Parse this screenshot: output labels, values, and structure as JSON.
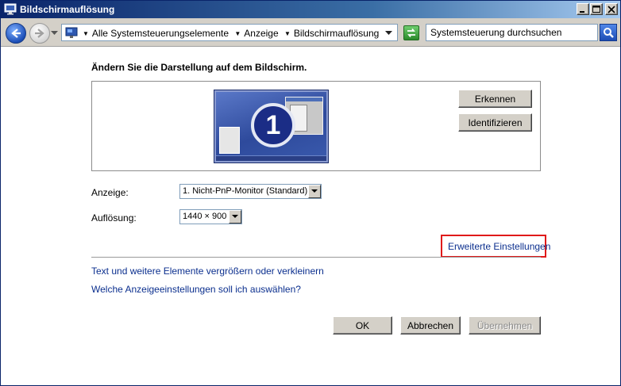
{
  "window": {
    "title": "Bildschirmauflösung"
  },
  "address": {
    "breadcrumbs": [
      "Alle Systemsteuerungselemente",
      "Anzeige",
      "Bildschirmauflösung"
    ],
    "search_placeholder": "Systemsteuerung durchsuchen"
  },
  "main": {
    "heading": "Ändern Sie die Darstellung auf dem Bildschirm.",
    "monitor_number": "1",
    "detect_label": "Erkennen",
    "identify_label": "Identifizieren",
    "display_label": "Anzeige:",
    "display_value": "1. Nicht-PnP-Monitor (Standard)",
    "resolution_label": "Auflösung:",
    "resolution_value": "1440 × 900",
    "advanced_link": "Erweiterte Einstellungen",
    "text_size_link": "Text und weitere Elemente vergrößern oder verkleinern",
    "which_settings_link": "Welche Anzeigeeinstellungen soll ich auswählen?"
  },
  "footer": {
    "ok_label": "OK",
    "cancel_label": "Abbrechen",
    "apply_label": "Übernehmen"
  },
  "colors": {
    "highlight": "#e01a1a",
    "link": "#0b2f8e",
    "monitor_blue": "#2e4a9c"
  }
}
